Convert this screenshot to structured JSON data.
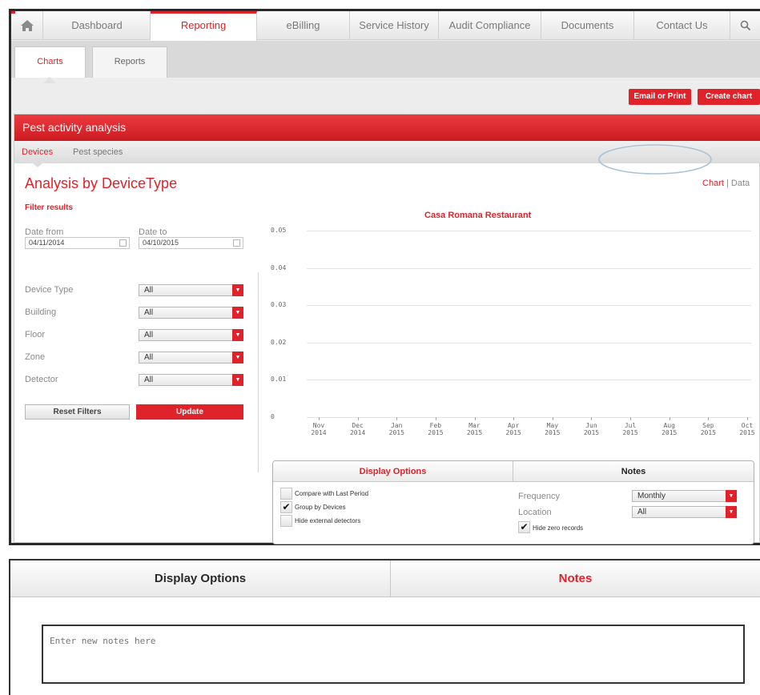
{
  "nav": {
    "items": [
      {
        "label": "Dashboard"
      },
      {
        "label": "Reporting"
      },
      {
        "label": "eBilling"
      },
      {
        "label": "Service History"
      },
      {
        "label": "Audit Compliance"
      },
      {
        "label": "Documents"
      },
      {
        "label": "Contact Us"
      }
    ],
    "active": "Reporting"
  },
  "subtabs": [
    {
      "label": "Charts"
    },
    {
      "label": "Reports"
    }
  ],
  "actions": {
    "email_print": "Email or Print",
    "create_chart": "Create chart"
  },
  "panel": {
    "title": "Pest activity analysis",
    "tabs": [
      {
        "label": "Devices"
      },
      {
        "label": "Pest species"
      }
    ],
    "heading": "Analysis by DeviceType",
    "view_chart": "Chart",
    "view_sep": "|",
    "view_data": "Data"
  },
  "filters": {
    "title": "Filter results",
    "date_from_label": "Date from",
    "date_from": "04/11/2014",
    "date_to_label": "Date to",
    "date_to": "04/10/2015",
    "selects": [
      {
        "label": "Device Type",
        "value": "All"
      },
      {
        "label": "Building",
        "value": "All"
      },
      {
        "label": "Floor",
        "value": "All"
      },
      {
        "label": "Zone",
        "value": "All"
      },
      {
        "label": "Detector",
        "value": "All"
      }
    ],
    "reset": "Reset Filters",
    "update": "Update"
  },
  "chart_data": {
    "type": "line",
    "title": "Casa Romana Restaurant",
    "categories": [
      "Nov 2014",
      "Dec 2014",
      "Jan 2015",
      "Feb 2015",
      "Mar 2015",
      "Apr 2015",
      "May 2015",
      "Jun 2015",
      "Jul 2015",
      "Aug 2015",
      "Sep 2015",
      "Oct 2015"
    ],
    "yticks": [
      "0.05",
      "0.04",
      "0.03",
      "0.02",
      "0.01",
      "0"
    ],
    "ylim": [
      0,
      0.05
    ],
    "series": [],
    "grid": true
  },
  "display_options": {
    "tab_display": "Display Options",
    "tab_notes": "Notes",
    "checks": [
      {
        "label": "Compare with Last Period",
        "checked": false
      },
      {
        "label": "Group by Devices",
        "checked": true
      },
      {
        "label": "Hide external detectors",
        "checked": false
      }
    ],
    "frequency_label": "Frequency",
    "frequency": "Monthly",
    "location_label": "Location",
    "location": "All",
    "hide_zero": "Hide zero records",
    "hide_zero_checked": true
  },
  "bottom": {
    "tab_display": "Display Options",
    "tab_notes": "Notes",
    "notes_placeholder": "Enter new notes here"
  },
  "colors": {
    "accent": "#e0222a"
  }
}
